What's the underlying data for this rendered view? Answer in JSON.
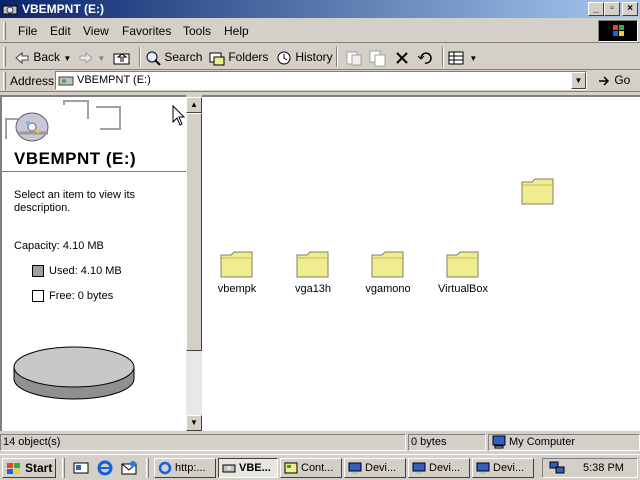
{
  "window": {
    "title": "VBEMPNT (E:)"
  },
  "menu": [
    "File",
    "Edit",
    "View",
    "Favorites",
    "Tools",
    "Help"
  ],
  "toolbar": {
    "back": "Back",
    "search": "Search",
    "folders": "Folders",
    "history": "History"
  },
  "address": {
    "label": "Address",
    "value": "VBEMPNT (E:)",
    "go": "Go"
  },
  "left_pane": {
    "title": "VBEMPNT (E:)",
    "description": "Select an item to view its description.",
    "capacity": "Capacity: 4.10 MB",
    "used": "Used: 4.10 MB",
    "free": "Free: 0 bytes",
    "used_fraction": 1.0
  },
  "folders": [
    "vbempk",
    "vga13h",
    "vgamono",
    "VirtualBox"
  ],
  "status": {
    "objects": "14 object(s)",
    "size": "0 bytes",
    "zone": "My Computer"
  },
  "taskbar": {
    "start": "Start",
    "buttons": [
      "http:...",
      "VBE...",
      "Cont...",
      "Devi...",
      "Devi...",
      "Devi..."
    ],
    "clock": "5:38 PM"
  },
  "colors": {
    "titlebar": "#0a246a",
    "folder": "#f0ec90"
  }
}
